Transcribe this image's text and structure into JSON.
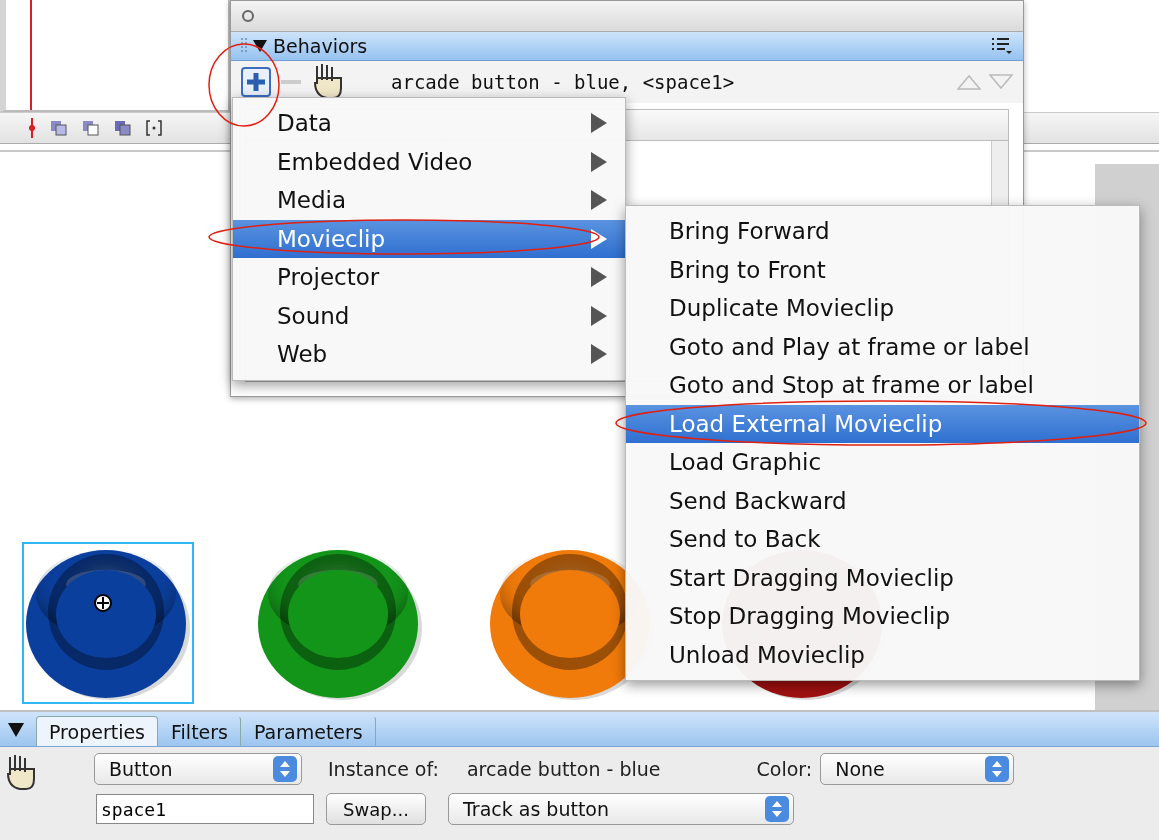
{
  "behaviors_panel": {
    "title": "Behaviors",
    "target": "arcade button - blue, <space1>"
  },
  "menu": {
    "items": [
      {
        "label": "Data",
        "selected": false
      },
      {
        "label": "Embedded Video",
        "selected": false
      },
      {
        "label": "Media",
        "selected": false
      },
      {
        "label": "Movieclip",
        "selected": true
      },
      {
        "label": "Projector",
        "selected": false
      },
      {
        "label": "Sound",
        "selected": false
      },
      {
        "label": "Web",
        "selected": false
      }
    ]
  },
  "submenu": {
    "items": [
      {
        "label": "Bring Forward",
        "selected": false
      },
      {
        "label": "Bring to Front",
        "selected": false
      },
      {
        "label": "Duplicate Movieclip",
        "selected": false
      },
      {
        "label": "Goto and Play at frame or label",
        "selected": false
      },
      {
        "label": "Goto and Stop at frame or label",
        "selected": false
      },
      {
        "label": "Load External Movieclip",
        "selected": true
      },
      {
        "label": "Load Graphic",
        "selected": false
      },
      {
        "label": "Send Backward",
        "selected": false
      },
      {
        "label": "Send to Back",
        "selected": false
      },
      {
        "label": "Start Dragging Movieclip",
        "selected": false
      },
      {
        "label": "Stop Dragging Movieclip",
        "selected": false
      },
      {
        "label": "Unload Movieclip",
        "selected": false
      }
    ]
  },
  "stage": {
    "buttons": [
      {
        "color": "#0b3f9e",
        "selected": true
      },
      {
        "color": "#13951a",
        "selected": false
      },
      {
        "color": "#f07a0a",
        "selected": false
      },
      {
        "color": "#a01010",
        "selected": false
      }
    ]
  },
  "properties_panel": {
    "tabs": [
      {
        "label": "Properties",
        "selected": true
      },
      {
        "label": "Filters",
        "selected": false
      },
      {
        "label": "Parameters",
        "selected": false
      }
    ],
    "symbol_type": "Button",
    "instance_of_label": "Instance of:",
    "instance_of": "arcade button - blue",
    "color_label": "Color:",
    "color_value": "None",
    "instance_name": "space1",
    "swap_button": "Swap...",
    "tracking": "Track as button"
  }
}
